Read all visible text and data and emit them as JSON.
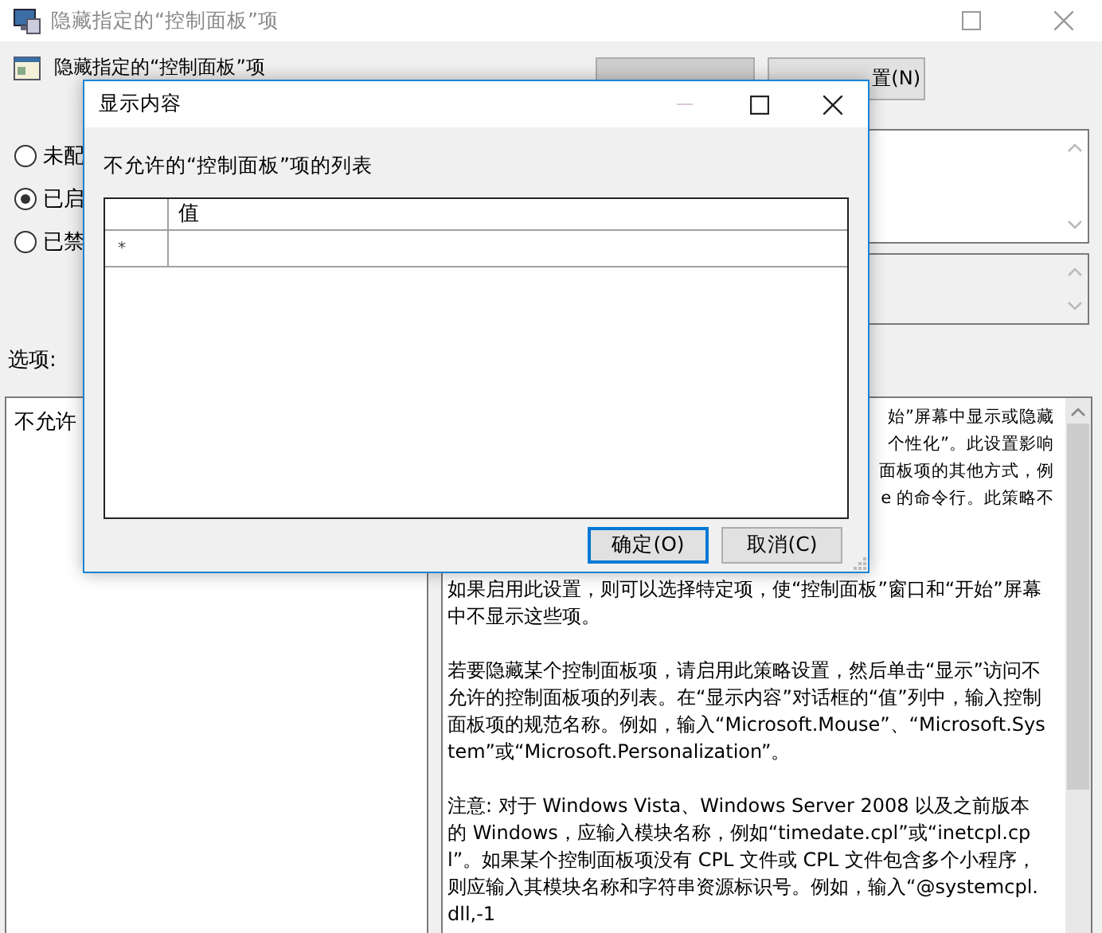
{
  "window": {
    "title": "隐藏指定的“控制面板”项"
  },
  "policy": {
    "heading": "隐藏指定的“控制面板”项",
    "next_button": "置(N)"
  },
  "state_options": [
    {
      "label": "未配",
      "selected": false
    },
    {
      "label": "已启",
      "selected": true
    },
    {
      "label": "已禁",
      "selected": false
    }
  ],
  "options_label": "选项:",
  "options_pane": {
    "text": "不允许"
  },
  "help_pane": {
    "cut_lines": [
      "始”屏幕中显示或隐藏",
      "个性化”。此设置影响",
      "面板项的其他方式，例",
      "e 的命令行。此策略不"
    ],
    "paragraphs": [
      "如果启用此设置，则可以选择特定项，使“控制面板”窗口和“开始”屏幕中不显示这些项。",
      "若要隐藏某个控制面板项，请启用此策略设置，然后单击“显示”访问不允许的控制面板项的列表。在“显示内容”对话框的“值”列中，输入控制面板项的规范名称。例如，输入“Microsoft.Mouse”、“Microsoft.System”或“Microsoft.Personalization”。",
      "注意: 对于 Windows Vista、Windows Server 2008 以及之前版本的 Windows，应输入模块名称，例如“timedate.cpl”或“inetcpl.cpl”。如果某个控制面板项没有 CPL 文件或 CPL 文件包含多个小程序，则应输入其模块名称和字符串资源标识号。例如，输入“@systemcpl.dll,-1"
    ]
  },
  "dialog": {
    "title": "显示内容",
    "list_label": "不允许的“控制面板”项的列表",
    "table": {
      "columns": [
        "值"
      ],
      "rows": [
        {
          "row_header": "*"
        }
      ]
    },
    "buttons": [
      {
        "label": "确定(O)",
        "default": true
      },
      {
        "label": "取消(C)",
        "default": false
      }
    ]
  }
}
